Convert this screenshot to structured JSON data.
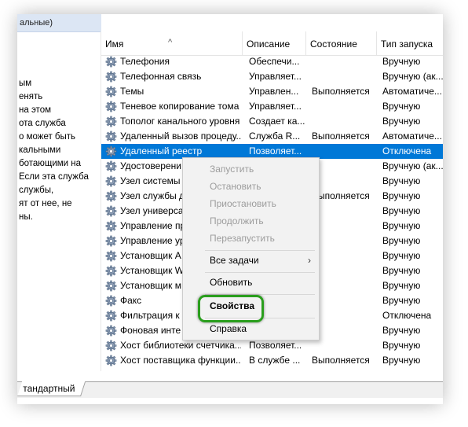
{
  "left_pane": {
    "header_text": "альные)",
    "description_lines": [
      "ым",
      "енять",
      " на этом",
      "ота служба",
      "о может быть",
      "кальными",
      "ботающими на",
      "Если эта служба",
      "службы,",
      "ят от нее, не",
      "ны."
    ]
  },
  "table": {
    "columns": {
      "name": "Имя",
      "description": "Описание",
      "state": "Состояние",
      "startup": "Тип запуска"
    },
    "sort_indicator": "^",
    "rows": [
      {
        "name": "Телефония",
        "description": "Обеспечи...",
        "state": "",
        "startup": "Вручную"
      },
      {
        "name": "Телефонная связь",
        "description": "Управляет...",
        "state": "",
        "startup": "Вручную (ак..."
      },
      {
        "name": "Темы",
        "description": "Управлен...",
        "state": "Выполняется",
        "startup": "Автоматиче..."
      },
      {
        "name": "Теневое копирование тома",
        "description": "Управляет...",
        "state": "",
        "startup": "Вручную"
      },
      {
        "name": "Тополог канального уровня",
        "description": "Создает ка...",
        "state": "",
        "startup": "Вручную"
      },
      {
        "name": "Удаленный вызов процеду...",
        "description": "Служба R...",
        "state": "Выполняется",
        "startup": "Автоматиче..."
      },
      {
        "name": "Удаленный реестр",
        "description": "Позволяет...",
        "state": "",
        "startup": "Отключена"
      },
      {
        "name": "Удостоверени",
        "description": "",
        "state": "",
        "startup": "Вручную (ак..."
      },
      {
        "name": "Узел системы",
        "description": "",
        "state": "",
        "startup": "Вручную"
      },
      {
        "name": "Узел службы д",
        "description": "",
        "state": "Выполняется",
        "startup": "Вручную"
      },
      {
        "name": "Узел универса",
        "description": "",
        "state": "",
        "startup": "Вручную"
      },
      {
        "name": "Управление пр",
        "description": "",
        "state": "",
        "startup": "Вручную"
      },
      {
        "name": "Управление ур",
        "description": "",
        "state": "",
        "startup": "Вручную"
      },
      {
        "name": "Установщик A",
        "description": "",
        "state": "",
        "startup": "Вручную"
      },
      {
        "name": "Установщик W",
        "description": "",
        "state": "",
        "startup": "Вручную"
      },
      {
        "name": "Установщик м",
        "description": "",
        "state": "",
        "startup": "Вручную"
      },
      {
        "name": "Факс",
        "description": "",
        "state": "",
        "startup": "Вручную"
      },
      {
        "name": "Фильтрация к",
        "description": "",
        "state": "",
        "startup": "Отключена"
      },
      {
        "name": "Фоновая инте",
        "description": "",
        "state": "",
        "startup": "Вручную"
      },
      {
        "name": "Хост библиотеки счетчика...",
        "description": "Позволяет...",
        "state": "",
        "startup": "Вручную"
      },
      {
        "name": "Хост поставщика функции...",
        "description": "В службе ...",
        "state": "Выполняется",
        "startup": "Вручную"
      }
    ]
  },
  "tabs": {
    "standard": "тандартный"
  },
  "context_menu": {
    "start": "Запустить",
    "stop": "Остановить",
    "pause": "Приостановить",
    "resume": "Продолжить",
    "restart": "Перезапустить",
    "all_tasks": "Все задачи",
    "all_tasks_arrow": "›",
    "refresh": "Обновить",
    "properties": "Свойства",
    "help": "Справка"
  },
  "colors": {
    "selection": "#0078d7",
    "highlight_border": "#2a9e1d"
  }
}
